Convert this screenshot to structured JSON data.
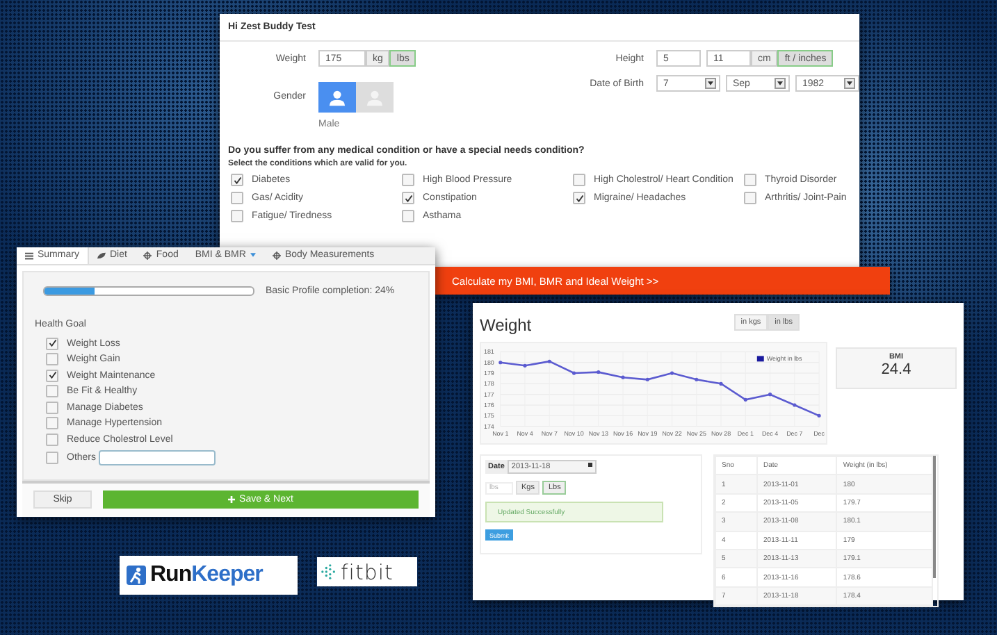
{
  "profile_form": {
    "title": "Hi Zest Buddy Test",
    "weight": {
      "label": "Weight",
      "value": "175",
      "units": [
        {
          "label": "kg",
          "selected": false
        },
        {
          "label": "lbs",
          "selected": true
        }
      ]
    },
    "height": {
      "label": "Height",
      "values": [
        "5",
        "11"
      ],
      "units": [
        {
          "label": "cm",
          "selected": false
        },
        {
          "label": "ft / inches",
          "selected": true
        }
      ]
    },
    "gender": {
      "label": "Gender",
      "options": [
        {
          "selected": true
        },
        {
          "selected": false
        }
      ],
      "caption": "Male"
    },
    "date_of_birth": {
      "label": "Date of Birth",
      "values": [
        "7",
        "Sep",
        "1982"
      ]
    },
    "question": "Do you suffer from any medical condition or have a special needs condition?",
    "instruction": "Select the conditions which are valid for you.",
    "conditions": [
      {
        "label": "Diabetes",
        "checked": true
      },
      {
        "label": "High Blood Pressure",
        "checked": false
      },
      {
        "label": "High Cholestrol/ Heart Condition",
        "checked": false
      },
      {
        "label": "Thyroid Disorder",
        "checked": false
      },
      {
        "label": "Gas/ Acidity",
        "checked": false
      },
      {
        "label": "Constipation",
        "checked": true
      },
      {
        "label": "Migraine/ Headaches",
        "checked": true
      },
      {
        "label": "Arthritis/ Joint-Pain",
        "checked": false
      },
      {
        "label": "Fatigue/ Tiredness",
        "checked": false
      },
      {
        "label": "Asthama",
        "checked": false
      }
    ],
    "calculate_button": "Calculate my BMI, BMR and Ideal Weight >>"
  },
  "goals_panel": {
    "tabs": [
      {
        "label": "Summary",
        "selected": true,
        "dropdown": false
      },
      {
        "label": "Diet",
        "selected": false,
        "dropdown": false
      },
      {
        "label": "Food",
        "selected": false,
        "dropdown": false
      },
      {
        "label": "BMI & BMR",
        "selected": false,
        "dropdown": true
      },
      {
        "label": "Body Measurements",
        "selected": false,
        "dropdown": false
      }
    ],
    "progress": {
      "level": 0.24,
      "label": "Basic Profile completion: 24%"
    },
    "goal_heading": "Health Goal",
    "goals": [
      {
        "label": "Weight Loss",
        "checked": true
      },
      {
        "label": "Weight Gain",
        "checked": false
      },
      {
        "label": "Weight Maintenance",
        "checked": true
      },
      {
        "label": "Be Fit & Healthy",
        "checked": false
      },
      {
        "label": "Manage Diabetes",
        "checked": false
      },
      {
        "label": "Manage Hypertension",
        "checked": false
      },
      {
        "label": "Reduce Cholestrol Level",
        "checked": false
      }
    ],
    "others": {
      "label": "Others",
      "checked": false
    },
    "skip_button": "Skip",
    "save_button": "Save & Next"
  },
  "weight_panel": {
    "title": "Weight",
    "unit_toggle": [
      {
        "label": "in kgs",
        "selected": false
      },
      {
        "label": "in lbs",
        "selected": true
      }
    ],
    "chart_data": {
      "type": "line",
      "grid": true,
      "categories": [
        "Nov 1",
        "Nov 4",
        "Nov 7",
        "Nov 10",
        "Nov 13",
        "Nov 16",
        "Nov 19",
        "Nov 22",
        "Nov 25",
        "Nov 28",
        "Dec 1",
        "Dec 4",
        "Dec 7",
        "Dec"
      ],
      "ylim": [
        174,
        181
      ],
      "yticks": [
        174,
        175,
        176,
        177,
        178,
        179,
        180,
        181
      ],
      "series": [
        {
          "name": "Weight in lbs",
          "color": "#5b5bd0",
          "values": [
            180,
            179.7,
            180.1,
            179,
            179.1,
            178.6,
            178.4,
            179,
            178.4,
            178,
            176.5,
            177,
            176,
            175
          ]
        }
      ]
    },
    "bmi": {
      "label": "BMI",
      "value": "24.4"
    },
    "entry": {
      "date_label": "Date",
      "date_value": "2013-11-18",
      "weight_placeholder": "lbs",
      "units": [
        {
          "label": "Kgs",
          "selected": false
        },
        {
          "label": "Lbs",
          "selected": true
        }
      ],
      "message": "Updated Successfully",
      "submit": "Submit"
    },
    "table": {
      "columns": [
        "Sno",
        "Date",
        "Weight (in lbs)"
      ],
      "rows": [
        [
          "1",
          "2013-11-01",
          "180"
        ],
        [
          "2",
          "2013-11-05",
          "179.7"
        ],
        [
          "3",
          "2013-11-08",
          "180.1"
        ],
        [
          "4",
          "2013-11-11",
          "179"
        ],
        [
          "5",
          "2013-11-13",
          "179.1"
        ],
        [
          "6",
          "2013-11-16",
          "178.6"
        ],
        [
          "7",
          "2013-11-18",
          "178.4"
        ]
      ]
    }
  },
  "logos": [
    {
      "kind": "runkeeper",
      "parts": [
        "Run",
        "Keeper"
      ]
    },
    {
      "kind": "fitbit",
      "parts": [
        "fitbit"
      ]
    }
  ]
}
